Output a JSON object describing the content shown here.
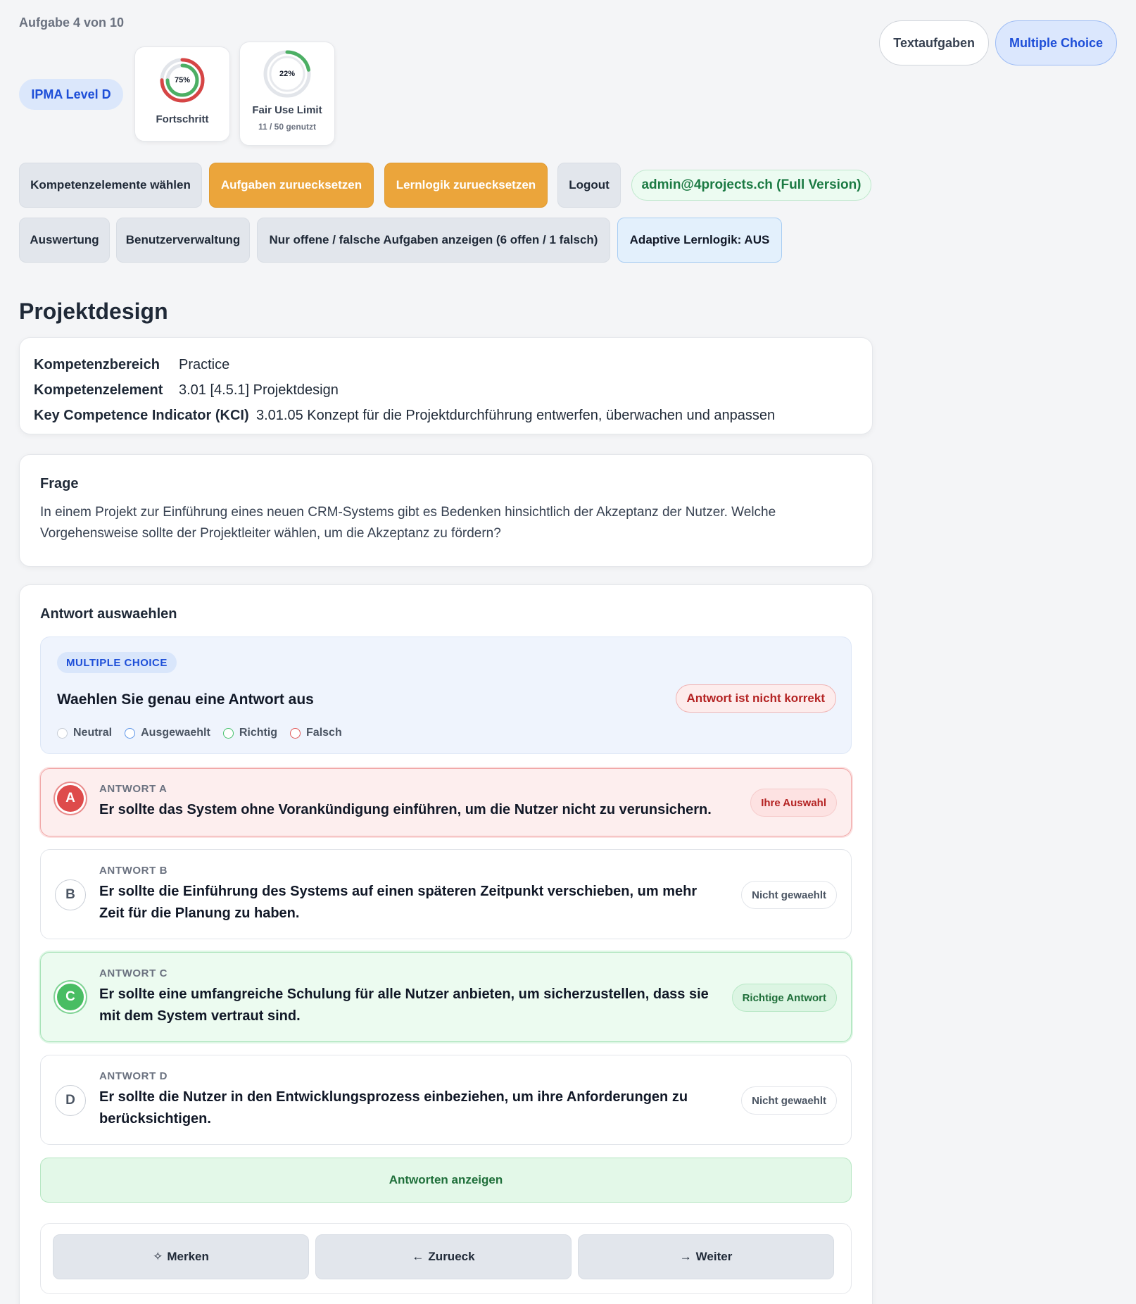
{
  "header": {
    "task_counter": "Aufgabe 4 von 10",
    "level": "IPMA Level D",
    "progress": {
      "percent_label": "75%",
      "value": 0.75,
      "title": "Fortschritt"
    },
    "fair_use": {
      "percent_label": "22%",
      "value": 0.22,
      "title": "Fair Use Limit",
      "sub": "11 / 50 genutzt"
    },
    "modes": [
      {
        "label": "Textaufgaben",
        "active": false
      },
      {
        "label": "Multiple Choice",
        "active": true
      }
    ]
  },
  "toolbar": {
    "row1": {
      "kompetenz": "Kompetenzelemente wählen",
      "reset_tasks": "Aufgaben zuruecksetzen",
      "reset_logic": "Lernlogik zuruecksetzen",
      "logout": "Logout"
    },
    "user": "admin@4projects.ch (Full Version)",
    "row2": {
      "auswertung": "Auswertung",
      "benutzer": "Benutzerverwaltung",
      "filter": "Nur offene / falsche Aufgaben anzeigen (6 offen / 1 falsch)",
      "adaptive": "Adaptive Lernlogik: AUS"
    }
  },
  "section_title": "Projektdesign",
  "info": {
    "bereich_key": "Kompetenzbereich",
    "bereich_val": "Practice",
    "element_key": "Kompetenzelement",
    "element_val": "3.01 [4.5.1] Projektdesign",
    "kci_key": "Key Competence Indicator (KCI)",
    "kci_val": "3.01.05 Konzept für die Projektdurchführung entwerfen, überwachen und anpassen"
  },
  "question": {
    "title": "Frage",
    "text": "In einem Projekt zur Einführung eines neuen CRM-Systems gibt es Bedenken hinsichtlich der Akzeptanz der Nutzer. Welche Vorgehensweise sollte der Projektleiter wählen, um die Akzeptanz zu fördern?"
  },
  "answer": {
    "title": "Antwort auswaehlen",
    "tag": "MULTIPLE CHOICE",
    "instruction": "Waehlen Sie genau eine Antwort aus",
    "status": "Antwort ist nicht korrekt",
    "legend": [
      "Neutral",
      "Ausgewaehlt",
      "Richtig",
      "Falsch"
    ],
    "options": [
      {
        "letter": "A",
        "label": "ANTWORT A",
        "text": "Er sollte das System ohne Vorankündigung einführen, um die Nutzer nicht zu verunsichern.",
        "badge": "Ihre Auswahl",
        "state": "wrong"
      },
      {
        "letter": "B",
        "label": "ANTWORT B",
        "text": "Er sollte die Einführung des Systems auf einen späteren Zeitpunkt verschieben, um mehr Zeit für die Planung zu haben.",
        "badge": "Nicht gewaehlt",
        "state": "neutral"
      },
      {
        "letter": "C",
        "label": "ANTWORT C",
        "text": "Er sollte eine umfangreiche Schulung für alle Nutzer anbieten, um sicherzustellen, dass sie mit dem System vertraut sind.",
        "badge": "Richtige Antwort",
        "state": "right"
      },
      {
        "letter": "D",
        "label": "ANTWORT D",
        "text": "Er sollte die Nutzer in den Entwicklungsprozess einbeziehen, um ihre Anforderungen zu berücksichtigen.",
        "badge": "Nicht gewaehlt",
        "state": "neutral"
      }
    ],
    "show_answers": "Antworten anzeigen"
  },
  "nav": {
    "bookmark": {
      "icon": "✧",
      "label": "Merken"
    },
    "back": {
      "icon": "←",
      "label": "Zurueck"
    },
    "next": {
      "icon": "→",
      "label": "Weiter"
    }
  },
  "colors": {
    "accent_blue": "#1d4ed8",
    "orange": "#eba53b",
    "correct_green": "#49bd63",
    "wrong_red": "#de4b4b"
  }
}
